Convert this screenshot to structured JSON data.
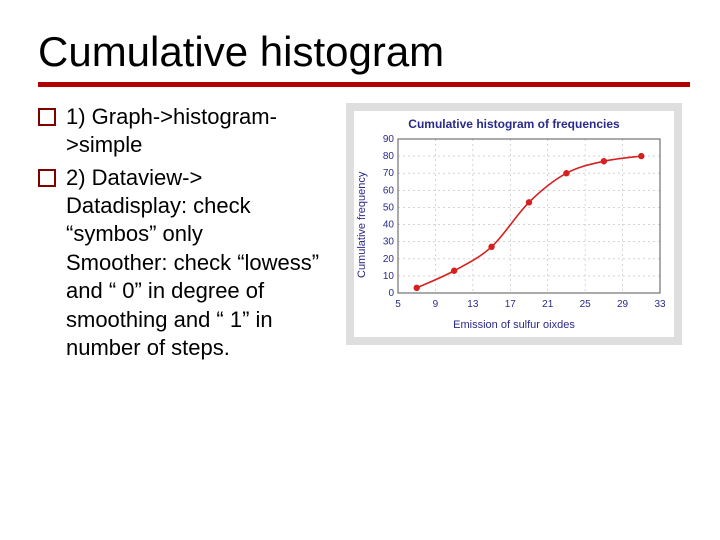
{
  "title": "Cumulative histogram",
  "bullets": [
    {
      "head": "1) Graph->histogram->simple"
    },
    {
      "head": "2) Dataview->",
      "sub1": "Datadisplay: check “symbos” only",
      "sub2": "Smoother: check “lowess” and “ 0” in degree of smoothing and “ 1” in number of steps."
    }
  ],
  "chart_data": {
    "type": "scatter",
    "title": "Cumulative histogram of frequencies",
    "xlabel": "Emission of sulfur oixdes",
    "ylabel": "Cumulative frequency",
    "xticks": [
      5,
      9,
      13,
      17,
      21,
      25,
      29,
      33
    ],
    "yticks": [
      0,
      10,
      20,
      30,
      40,
      50,
      60,
      70,
      80,
      90
    ],
    "xlim": [
      5,
      33
    ],
    "ylim": [
      0,
      90
    ],
    "series": [
      {
        "name": "cumulative",
        "x": [
          7,
          11,
          15,
          19,
          23,
          27,
          31
        ],
        "values": [
          3,
          13,
          27,
          53,
          70,
          77,
          80
        ]
      }
    ]
  }
}
